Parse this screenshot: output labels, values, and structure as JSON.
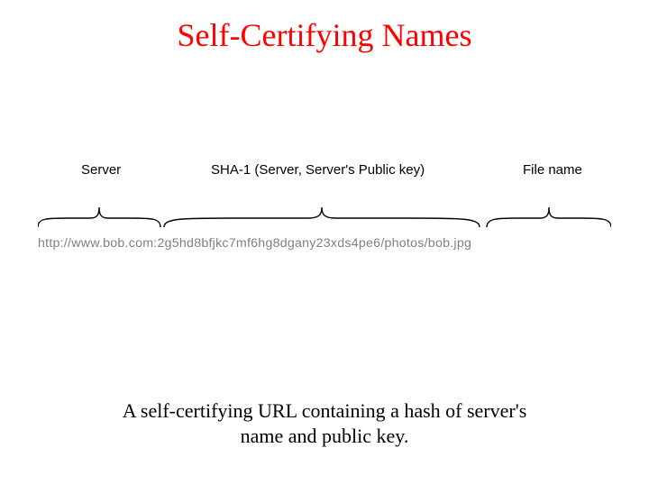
{
  "title": "Self-Certifying Names",
  "labels": {
    "server": "Server",
    "sha1": "SHA-1 (Server, Server's Public key)",
    "file": "File name"
  },
  "url": {
    "scheme_host": "http://www.bob.com:",
    "hash": "2g5hd8bfjkc7mf6hg8dgany23xds4pe6",
    "sep": "/",
    "path": "photos/bob.jpg"
  },
  "caption_line1": "A self-certifying URL containing a hash of server's",
  "caption_line2": "name and public key."
}
